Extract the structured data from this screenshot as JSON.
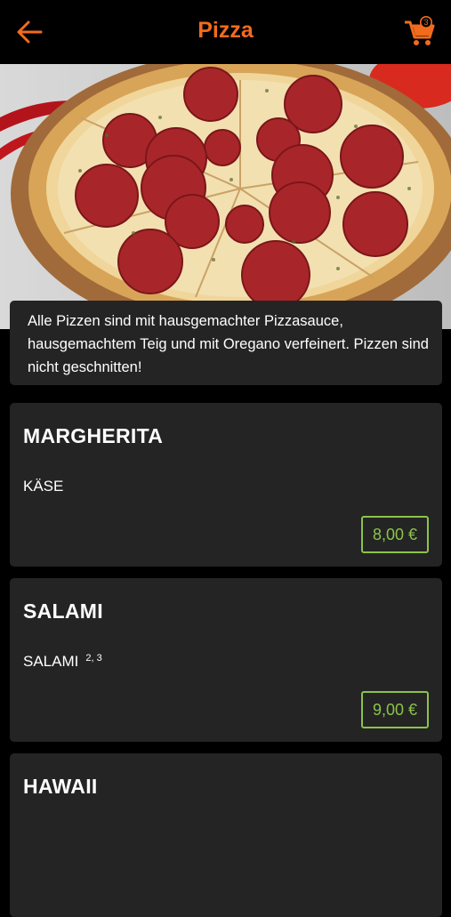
{
  "header": {
    "title": "Pizza",
    "cart_count": "3"
  },
  "info_text": "Alle Pizzen sind mit hausgemachter Pizzasauce, hausgemachtem Teig und mit Oregano verfeinert. Pizzen sind nicht geschnitten!",
  "items": [
    {
      "name": "MARGHERITA",
      "description": "KÄSE",
      "additives": "",
      "price": "8,00 €"
    },
    {
      "name": "SALAMI",
      "description": "SALAMI",
      "additives": "2, 3",
      "price": "9,00 €"
    },
    {
      "name": "HAWAII"
    }
  ],
  "colors": {
    "accent": "#f26b1d",
    "price": "#8bc34a",
    "card_bg": "#242424",
    "background": "#000000"
  }
}
